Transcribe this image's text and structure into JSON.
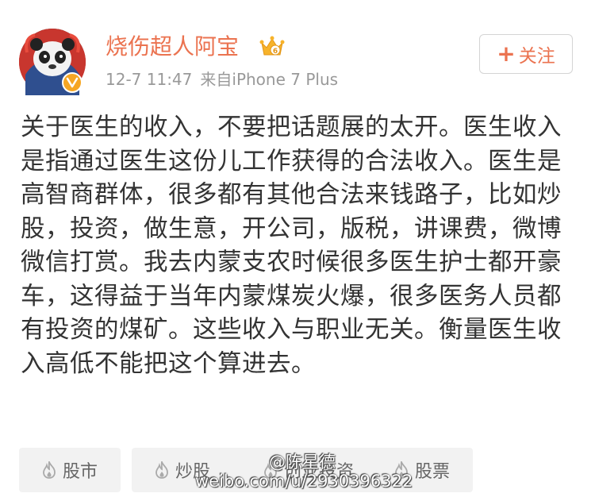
{
  "post": {
    "user_name": "烧伤超人阿宝",
    "timestamp": "12-7 11:47",
    "source": "来自iPhone 7 Plus",
    "follow_label": "关注",
    "follow_plus": "+",
    "body": "关于医生的收入，不要把话题展的太开。医生收入是指通过医生这份儿工作获得的合法收入。医生是高智商群体，很多都有其他合法来钱路子，比如炒股，投资，做生意，开公司，版税，讲课费，微博微信打赏。我去内蒙支农时候很多医生护士都开豪车，这得益于当年内蒙煤炭火爆，很多医务人员都有投资的煤矿。这些收入与职业无关。衡量医生收入高低不能把这个算进去。",
    "tags": [
      {
        "label": "股市",
        "icon": "flame-icon"
      },
      {
        "label": "炒股",
        "icon": "flame-icon"
      },
      {
        "label": "创业投资",
        "icon": "flame-icon"
      },
      {
        "label": "股票",
        "icon": "flame-icon"
      }
    ]
  },
  "watermark": {
    "user": "@陈星德",
    "url": "weibo.com/u/2930396322"
  },
  "colors": {
    "user_name": "#eb7350",
    "meta": "#999999",
    "body_text": "#333333",
    "tag_bg": "#f2f2f2",
    "verified_badge": "#f6a623"
  },
  "icons": {
    "avatar_badge": "verified-icon",
    "crown": "vip-crown-icon"
  }
}
